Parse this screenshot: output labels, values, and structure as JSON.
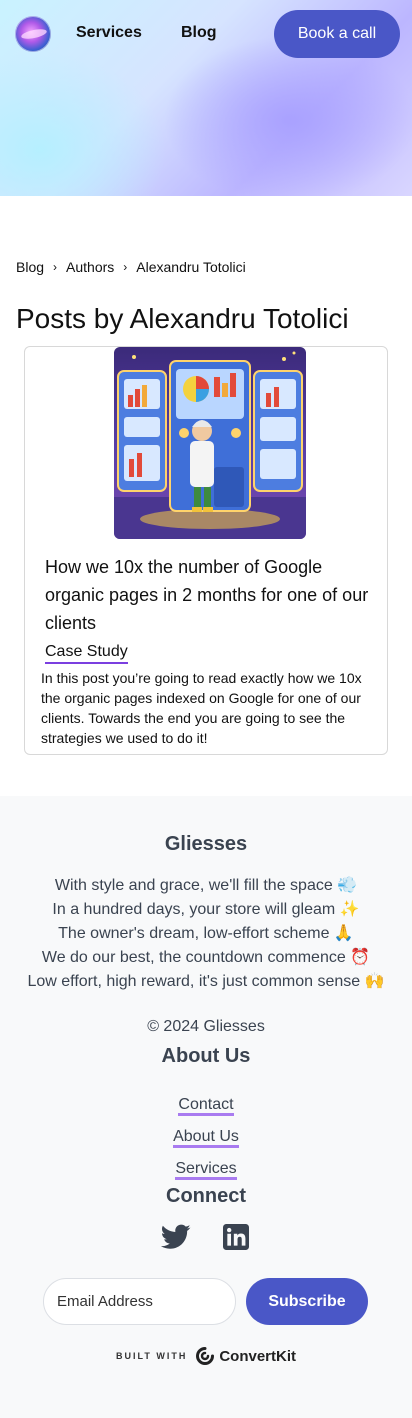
{
  "header": {
    "nav": [
      {
        "label": "Services"
      },
      {
        "label": "Blog"
      }
    ],
    "cta_label": "Book a call"
  },
  "breadcrumb": [
    "Blog",
    "Authors",
    "Alexandru Totolici"
  ],
  "breadcrumb_separator": "›",
  "page_title": "Posts by Alexandru Totolici",
  "post": {
    "title": "How we 10x the number of Google organic pages in 2 months for one of our clients",
    "tag": "Case Study",
    "excerpt": "In this post you’re going to read exactly how we 10x the organic pages indexed on Google for one of our clients. Towards the end you are going to see the strategies we used to do it!"
  },
  "footer": {
    "brand": "Gliesses",
    "poem": [
      "With style and grace, we'll fill the space 💨",
      "In a hundred days, your store will gleam ✨",
      "The owner's dream, low-effort scheme 🙏",
      "We do our best, the countdown commence ⏰",
      "Low effort, high reward, it's just common sense 🙌"
    ],
    "copyright": "© 2024 Gliesses",
    "about_heading": "About Us",
    "links": [
      {
        "label": "Contact"
      },
      {
        "label": "About Us"
      },
      {
        "label": "Services"
      }
    ],
    "connect_heading": "Connect",
    "social": [
      "twitter-icon",
      "linkedin-icon"
    ],
    "email_placeholder": "Email Address",
    "subscribe_label": "Subscribe",
    "built_with": "BUILT WITH",
    "built_brand": "ConvertKit"
  },
  "colors": {
    "primary_button": "#4a57c7",
    "link_underline": "#a97bf0",
    "footer_bg": "#f8f9fa"
  }
}
